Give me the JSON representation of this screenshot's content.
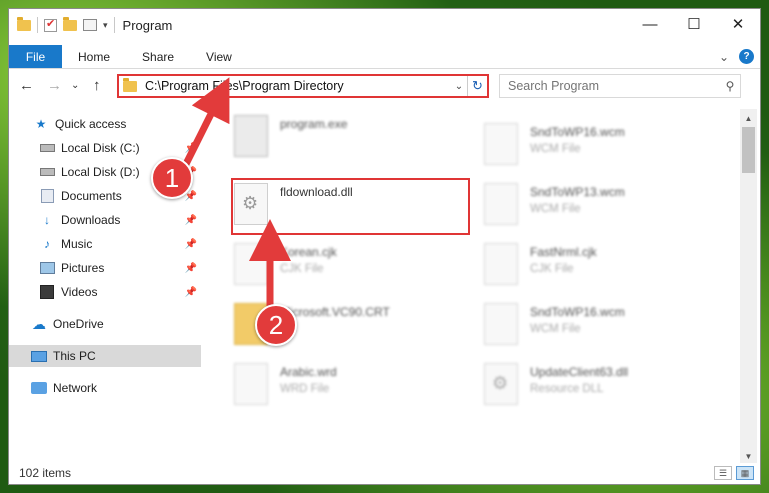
{
  "window": {
    "title": "Program",
    "controls": {
      "minimize": "—",
      "maximize": "☐",
      "close": "✕"
    }
  },
  "ribbon": {
    "tabs": [
      "File",
      "Home",
      "Share",
      "View"
    ],
    "expand": "⌄",
    "help": "?"
  },
  "address": {
    "back": "←",
    "forward": "→",
    "recent": "⌄",
    "up": "↑",
    "path": "C:\\Program Files\\Program Directory",
    "dropdown": "⌄",
    "refresh": "↻",
    "search_placeholder": "Search Program",
    "search_icon": "search-icon"
  },
  "sidebar": {
    "items": [
      {
        "label": "Quick access",
        "icon": "star-icon",
        "pinned": false
      },
      {
        "label": "Local Disk (C:)",
        "icon": "drive-icon",
        "pinned": true
      },
      {
        "label": "Local Disk (D:)",
        "icon": "drive-icon",
        "pinned": true
      },
      {
        "label": "Documents",
        "icon": "documents-icon",
        "pinned": true
      },
      {
        "label": "Downloads",
        "icon": "download-arrow-icon",
        "pinned": true
      },
      {
        "label": "Music",
        "icon": "music-note-icon",
        "pinned": true
      },
      {
        "label": "Pictures",
        "icon": "pictures-icon",
        "pinned": true
      },
      {
        "label": "Videos",
        "icon": "film-icon",
        "pinned": true
      },
      {
        "label": "OneDrive",
        "icon": "cloud-icon",
        "pinned": false
      },
      {
        "label": "This PC",
        "icon": "monitor-icon",
        "pinned": false,
        "selected": true
      },
      {
        "label": "Network",
        "icon": "network-icon",
        "pinned": false
      }
    ],
    "pin_glyph": "📌"
  },
  "files": [
    {
      "name": "program.exe",
      "type": "",
      "icon": "exe-icon"
    },
    {
      "name": "fldownload.dll",
      "type": "",
      "icon": "dll-gear-icon",
      "highlighted": true
    },
    {
      "name": "Korean.cjk",
      "type": "CJK File",
      "icon": "file-icon"
    },
    {
      "name": "Microsoft.VC90.CRT",
      "type": "",
      "icon": "folder-icon"
    },
    {
      "name": "Arabic.wrd",
      "type": "WRD File",
      "icon": "file-icon"
    },
    {
      "name": "SndToWP16.wcm",
      "type": "WCM File",
      "icon": "file-icon"
    },
    {
      "name": "SndToWP13.wcm",
      "type": "WCM File",
      "icon": "file-icon"
    },
    {
      "name": "FastNrml.cjk",
      "type": "CJK File",
      "icon": "file-icon"
    },
    {
      "name": "SndToWP16.wcm",
      "type": "WCM File",
      "icon": "file-icon"
    },
    {
      "name": "UpdateClient63.dll",
      "type": "Resource DLL",
      "icon": "dll-gear-icon"
    }
  ],
  "status": {
    "count": "102 items"
  },
  "annotations": [
    {
      "number": "1"
    },
    {
      "number": "2"
    }
  ],
  "colors": {
    "accent": "#1979ca",
    "highlight": "#e03535",
    "badge": "#e23b3b"
  }
}
